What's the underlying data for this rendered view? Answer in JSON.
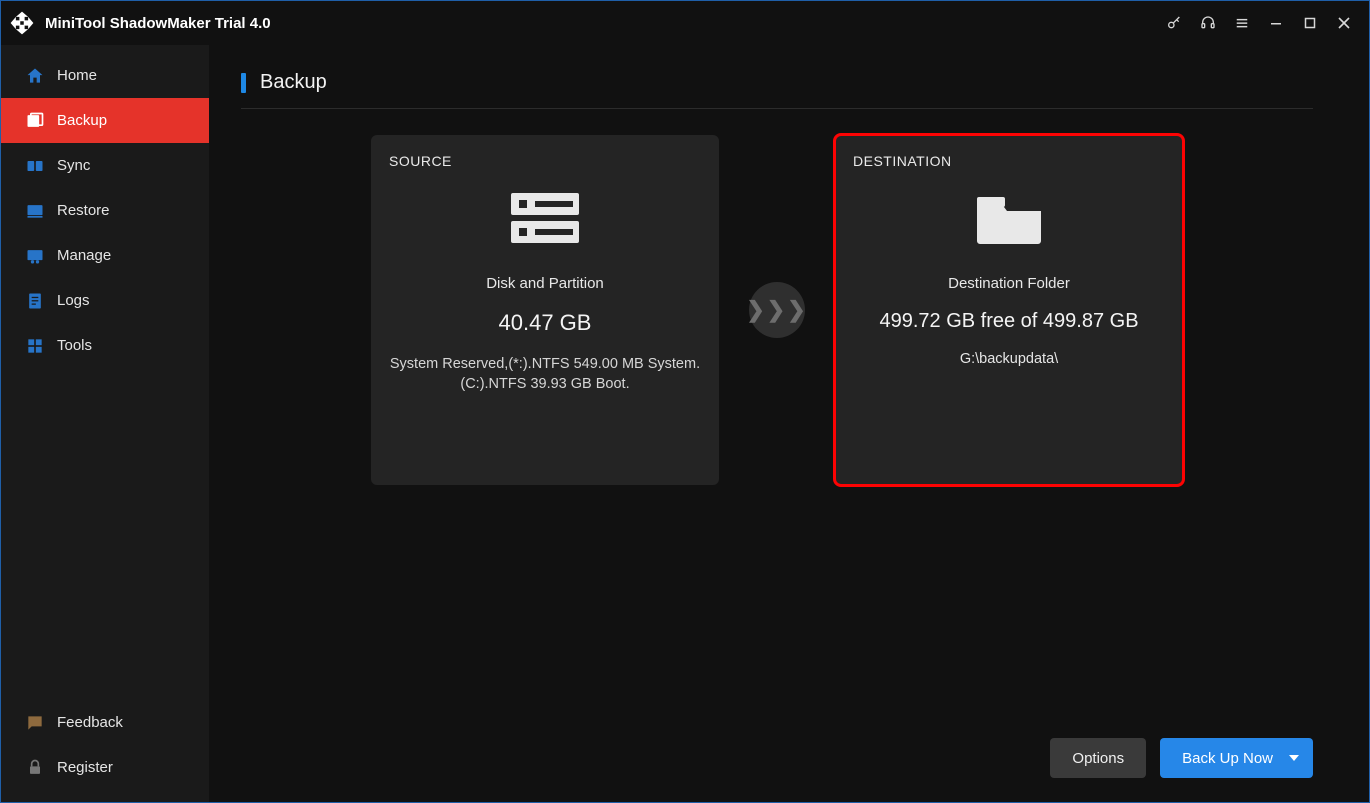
{
  "app": {
    "title": "MiniTool ShadowMaker Trial 4.0"
  },
  "nav": {
    "home": "Home",
    "backup": "Backup",
    "sync": "Sync",
    "restore": "Restore",
    "manage": "Manage",
    "logs": "Logs",
    "tools": "Tools",
    "feedback": "Feedback",
    "register": "Register"
  },
  "page": {
    "title": "Backup"
  },
  "source": {
    "title": "SOURCE",
    "label": "Disk and Partition",
    "size": "40.47 GB",
    "detail1": "System Reserved,(*:).NTFS 549.00 MB System.",
    "detail2": "(C:).NTFS 39.93 GB Boot."
  },
  "destination": {
    "title": "DESTINATION",
    "label": "Destination Folder",
    "free": "499.72 GB free of 499.87 GB",
    "path": "G:\\backupdata\\"
  },
  "arrow": "❯❯❯",
  "footer": {
    "options": "Options",
    "backupnow": "Back Up Now"
  }
}
